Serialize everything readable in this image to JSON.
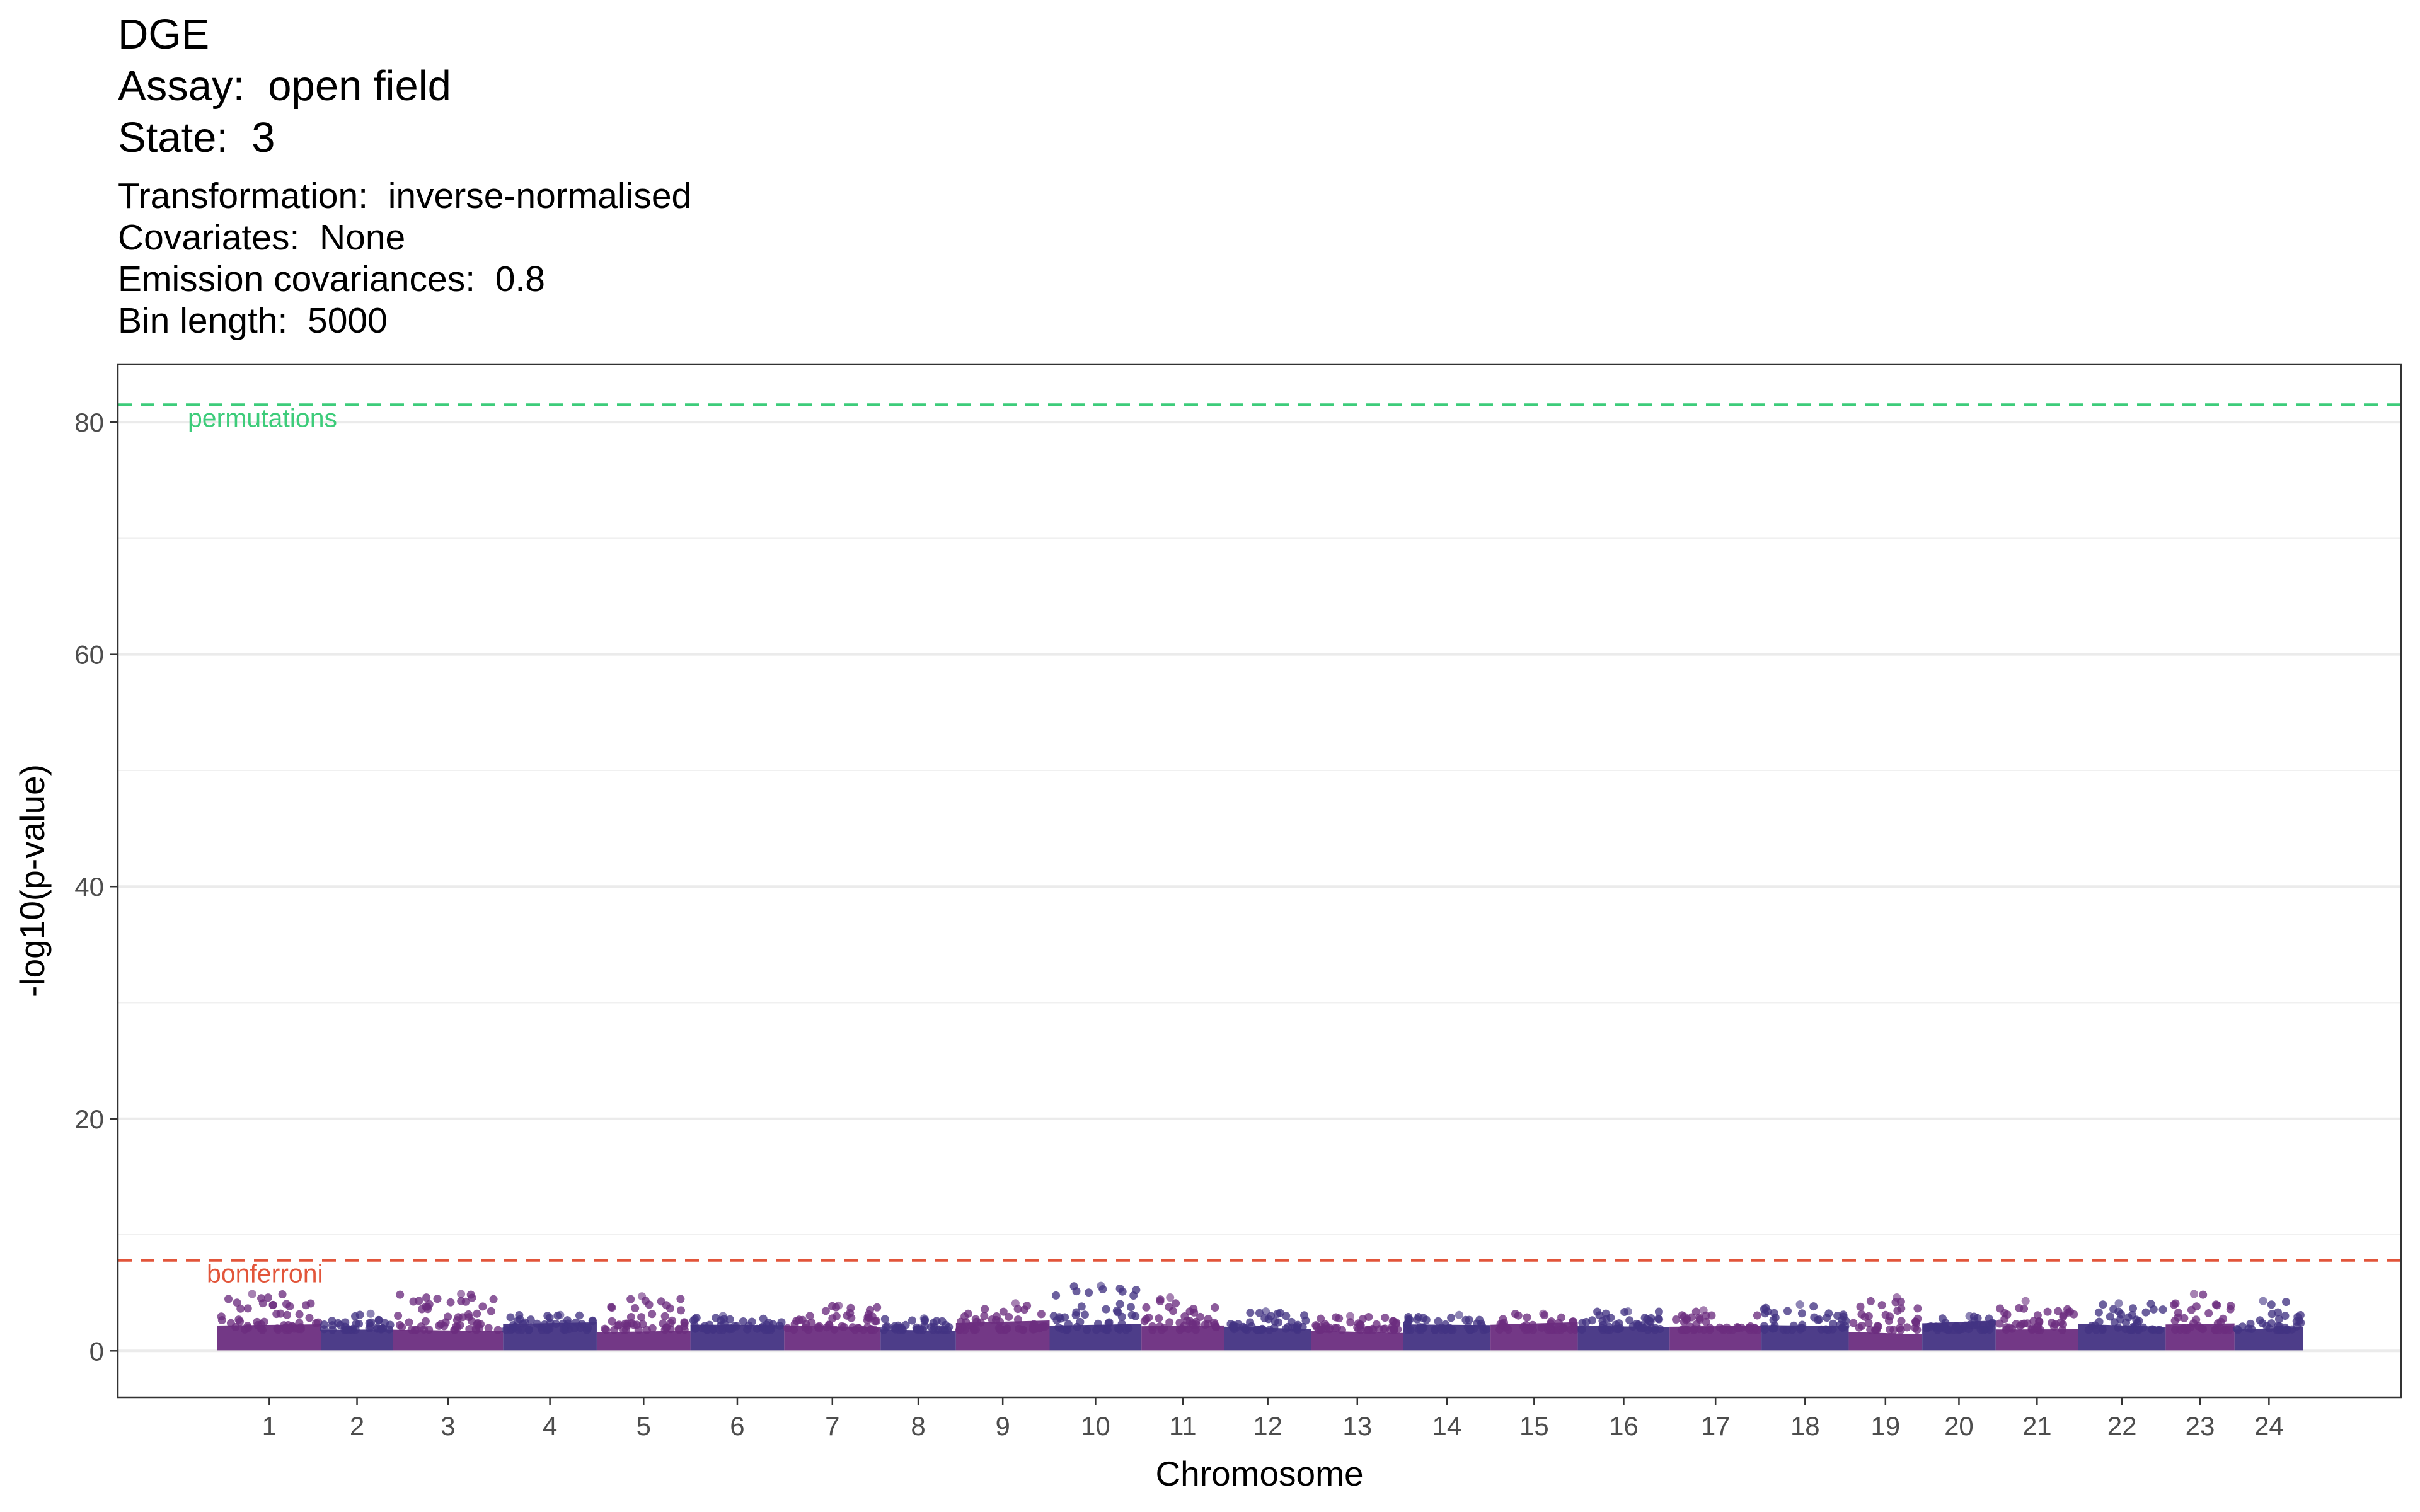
{
  "header": {
    "title_lines": [
      "DGE",
      "Assay:  open field",
      "State:  3"
    ],
    "subtitle_lines": [
      "Transformation:  inverse-normalised",
      "Covariates:  None",
      "Emission covariances:  0.8",
      "Bin length:  5000"
    ]
  },
  "chart_data": {
    "type": "scatter",
    "title": "DGE\nAssay:  open field\nState:  3",
    "subtitle": "Transformation:  inverse-normalised\nCovariates:  None\nEmission covariances:  0.8\nBin length:  5000",
    "xlabel": "Chromosome",
    "ylabel": "-log10(p-value)",
    "ylim": [
      -4,
      85
    ],
    "y_ticks": [
      0,
      20,
      40,
      60,
      80
    ],
    "grid": true,
    "colors": {
      "purple": "#6B2D7F",
      "indigo": "#433383"
    },
    "chromosomes": [
      {
        "label": "1",
        "color": "purple",
        "max": 4.9
      },
      {
        "label": "2",
        "color": "indigo",
        "max": 3.2
      },
      {
        "label": "3",
        "color": "purple",
        "max": 4.9
      },
      {
        "label": "4",
        "color": "indigo",
        "max": 3.1
      },
      {
        "label": "5",
        "color": "purple",
        "max": 4.7
      },
      {
        "label": "6",
        "color": "indigo",
        "max": 3.0
      },
      {
        "label": "7",
        "color": "purple",
        "max": 3.9
      },
      {
        "label": "8",
        "color": "indigo",
        "max": 2.8
      },
      {
        "label": "9",
        "color": "purple",
        "max": 4.1
      },
      {
        "label": "10",
        "color": "indigo",
        "max": 5.6
      },
      {
        "label": "11",
        "color": "purple",
        "max": 4.6
      },
      {
        "label": "12",
        "color": "indigo",
        "max": 3.4
      },
      {
        "label": "13",
        "color": "purple",
        "max": 3.0
      },
      {
        "label": "14",
        "color": "indigo",
        "max": 3.1
      },
      {
        "label": "15",
        "color": "purple",
        "max": 3.2
      },
      {
        "label": "16",
        "color": "indigo",
        "max": 3.4
      },
      {
        "label": "17",
        "color": "purple",
        "max": 3.5
      },
      {
        "label": "18",
        "color": "indigo",
        "max": 4.0
      },
      {
        "label": "19",
        "color": "purple",
        "max": 4.6
      },
      {
        "label": "20",
        "color": "indigo",
        "max": 3.0
      },
      {
        "label": "21",
        "color": "purple",
        "max": 4.3
      },
      {
        "label": "22",
        "color": "indigo",
        "max": 4.1
      },
      {
        "label": "23",
        "color": "purple",
        "max": 4.9
      },
      {
        "label": "24",
        "color": "indigo",
        "max": 4.3
      }
    ],
    "reference_lines": [
      {
        "label": "permutations",
        "y": 81.5,
        "color": "#3DCC7A"
      },
      {
        "label": "bonferroni",
        "y": 7.8,
        "color": "#E2553A"
      }
    ]
  }
}
